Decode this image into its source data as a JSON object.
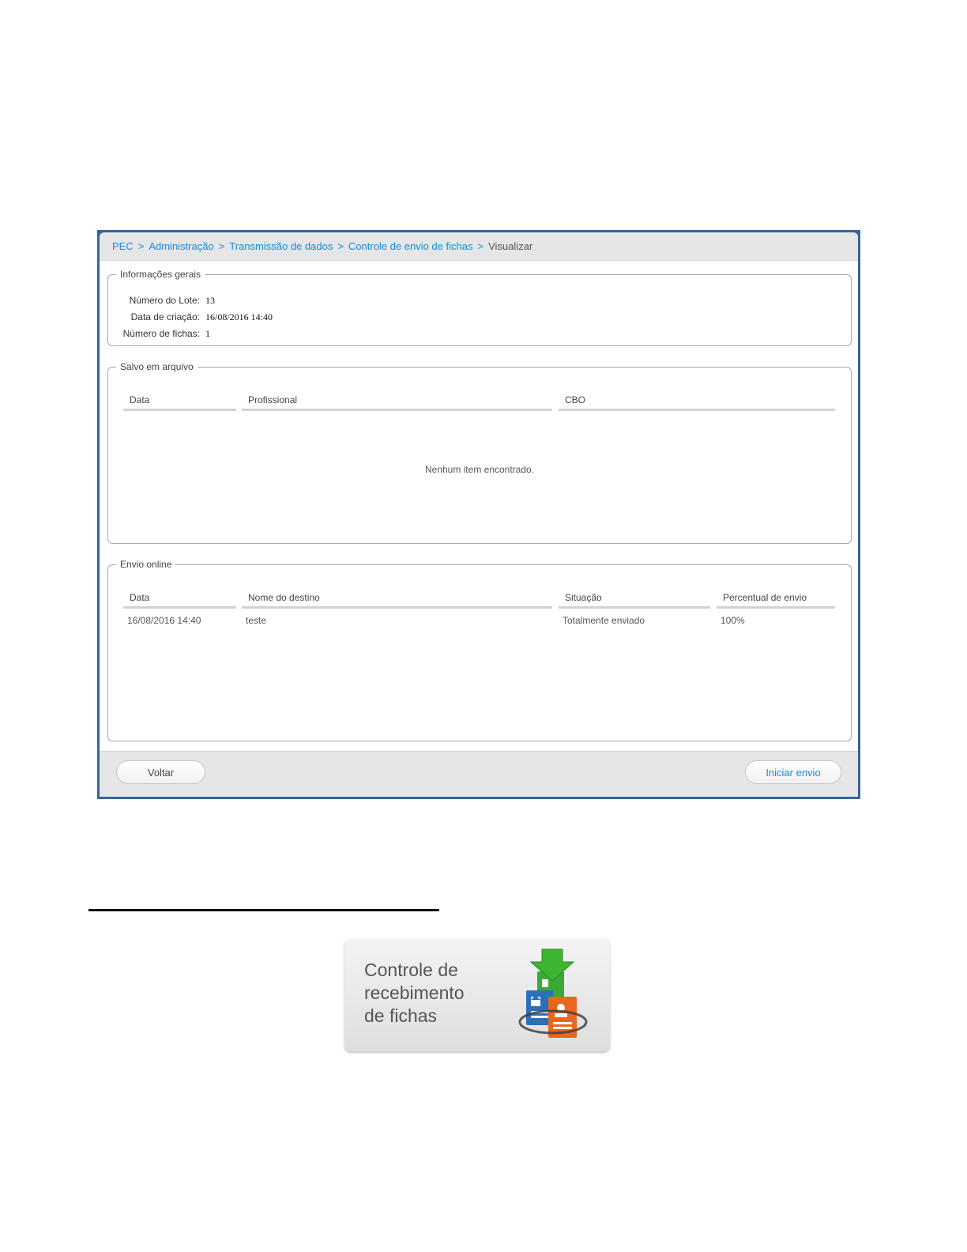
{
  "breadcrumb": {
    "items": [
      "PEC",
      "Administração",
      "Transmissão de dados",
      "Controle de envio de fichas"
    ],
    "separator": ">",
    "current": "Visualizar"
  },
  "info": {
    "legend": "Informações gerais",
    "lote_label": "Número do Lote:",
    "lote_value": "13",
    "data_label": "Data de criação:",
    "data_value": "16/08/2016 14:40",
    "fichas_label": "Número de fichas:",
    "fichas_value": "1"
  },
  "saved": {
    "legend": "Salvo em arquivo",
    "columns": [
      "Data",
      "Profissional",
      "CBO"
    ],
    "empty_message": "Nenhum item encontrado."
  },
  "online": {
    "legend": "Envio online",
    "columns": [
      "Data",
      "Nome do destino",
      "Situação",
      "Percentual de envio"
    ],
    "rows": [
      [
        "16/08/2016 14:40",
        "teste",
        "Totalmente enviado",
        "100%"
      ]
    ]
  },
  "footer": {
    "back_label": "Voltar",
    "start_label": "Iniciar envio"
  },
  "card": {
    "line1": "Controle de",
    "line2": "recebimento",
    "line3": "de fichas",
    "icon": "fichas-download-icon"
  },
  "colors": {
    "link": "#1a8bd6",
    "frame": "#336699"
  }
}
